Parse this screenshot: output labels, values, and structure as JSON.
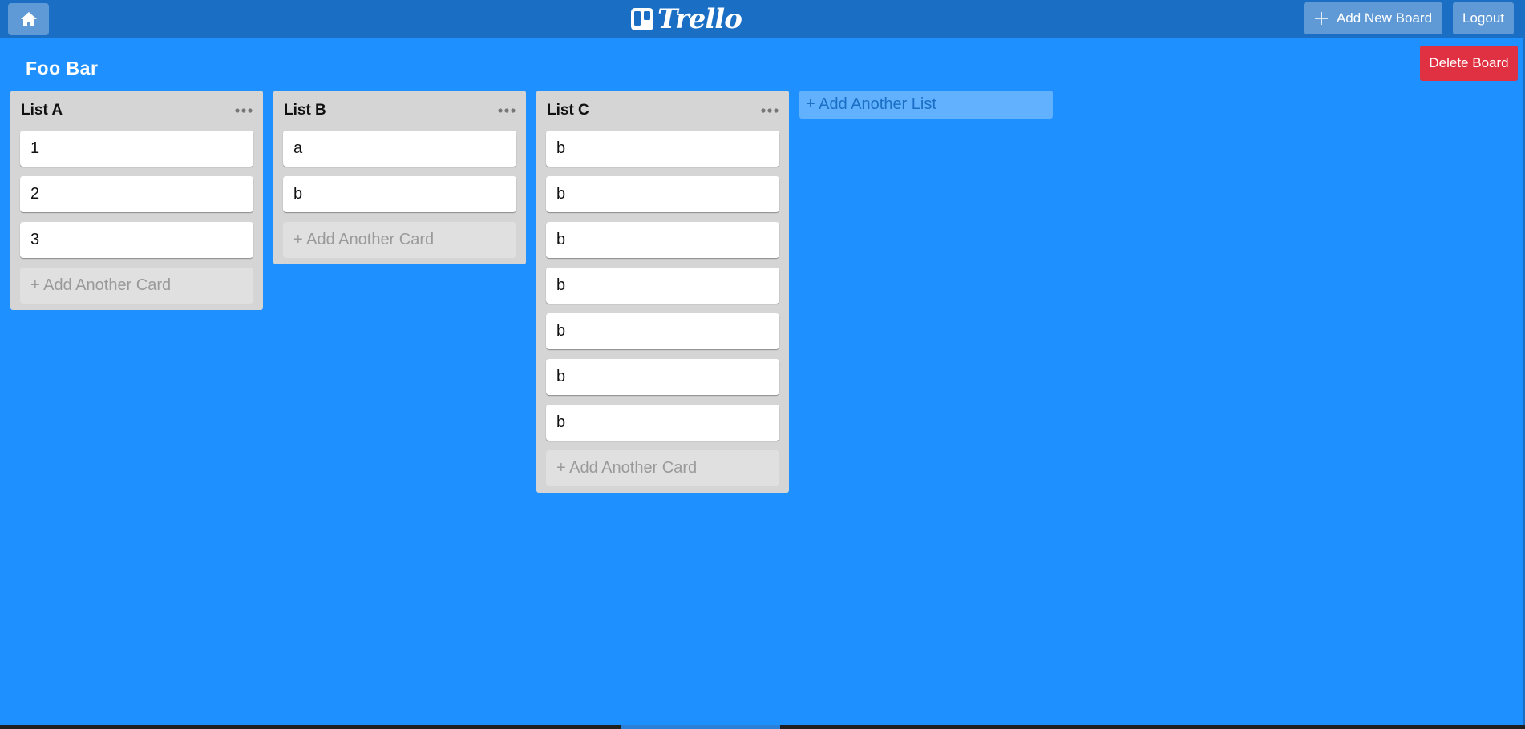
{
  "header": {
    "logo_text": "Trello",
    "add_board_label": "Add New Board",
    "logout_label": "Logout"
  },
  "board": {
    "title": "Foo Bar",
    "delete_label": "Delete Board",
    "add_list_label": "+ Add Another List",
    "add_card_label": "+ Add Another Card",
    "lists": [
      {
        "title": "List A",
        "cards": [
          "1",
          "2",
          "3"
        ]
      },
      {
        "title": "List B",
        "cards": [
          "a",
          "b"
        ]
      },
      {
        "title": "List C",
        "cards": [
          "b",
          "b",
          "b",
          "b",
          "b",
          "b",
          "b"
        ]
      }
    ]
  },
  "colors": {
    "board_background": "#1e90ff",
    "header_background": "#1a6fc4",
    "list_background": "#d5d5d5",
    "delete_button": "#e03142"
  },
  "icons": {
    "home": "home-icon",
    "logo": "trello-logo-icon",
    "add": "plus-icon",
    "list_menu": "more-horizontal-icon"
  }
}
